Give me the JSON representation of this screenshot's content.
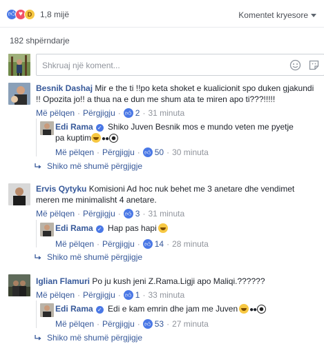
{
  "header": {
    "reaction_count": "1,8 mijë",
    "sort_label": "Komentet kryesore",
    "shares": "182 shpërndarje"
  },
  "composer": {
    "placeholder": "Shkruaj një koment..."
  },
  "colors": {
    "link": "#365899",
    "meta": "#90949c",
    "accent": "#4a78e6",
    "love": "#f25268",
    "haha": "#f7c843"
  },
  "actions": {
    "like": "Më pëlqen",
    "reply": "Përgjigju",
    "view_more": "Shiko më shumë përgjigje"
  },
  "comments": [
    {
      "author": "Besnik Dashaj",
      "text": "Mir e the ti !!po keta shoket e kualicionit spo duken gjakundi !! Opozita jo!! a thua na e dun me shum ata te miren apo ti???!!!!!",
      "likes": "2",
      "time": "31 minuta",
      "reply": {
        "author": "Edi Rama",
        "text": "Shiko Juven Besnik mos e mundo veten me pyetje pa kuptim",
        "likes": "50",
        "time": "30 minuta"
      }
    },
    {
      "author": "Ervis Qytyku",
      "text": "Komisioni Ad hoc nuk behet me 3 anetare dhe vendimet meren me minimalisht 4 anetare.",
      "likes": "3",
      "time": "31 minuta",
      "reply": {
        "author": "Edi Rama",
        "text": "Hap pas hapi",
        "likes": "14",
        "time": "28 minuta"
      }
    },
    {
      "author": "Iglian Flamuri",
      "text": "Po ju kush jeni Z.Rama.Ligji apo Maliqi.??????",
      "likes": "1",
      "time": "33 minuta",
      "reply": {
        "author": "Edi Rama",
        "text": "Edi e kam emrin dhe jam me Juven",
        "likes": "53",
        "time": "27 minuta"
      }
    }
  ]
}
